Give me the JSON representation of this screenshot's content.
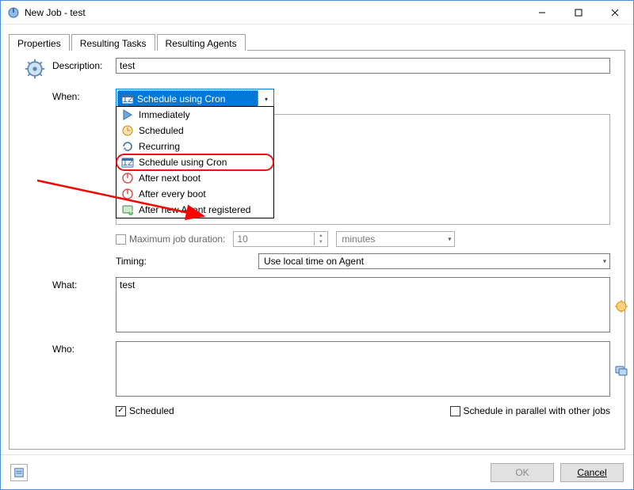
{
  "window": {
    "title": "New Job - test"
  },
  "tabs": [
    "Properties",
    "Resulting Tasks",
    "Resulting Agents"
  ],
  "active_tab": 0,
  "form": {
    "description_label": "Description:",
    "description_value": "test",
    "when_label": "When:",
    "when_selected": "Schedule using Cron",
    "when_options": [
      {
        "icon": "play-icon",
        "label": "Immediately"
      },
      {
        "icon": "clock-icon",
        "label": "Scheduled"
      },
      {
        "icon": "recur-icon",
        "label": "Recurring"
      },
      {
        "icon": "calendar-icon",
        "label": "Schedule using Cron"
      },
      {
        "icon": "boot-icon",
        "label": "After next boot"
      },
      {
        "icon": "boot-icon",
        "label": "After every boot"
      },
      {
        "icon": "agent-icon",
        "label": "After new Agent registered"
      }
    ],
    "max_duration_label": "Maximum job duration:",
    "max_duration_value": "10",
    "max_duration_unit": "minutes",
    "timing_label": "Timing:",
    "timing_value": "Use local time on Agent",
    "what_label": "What:",
    "what_value": "test",
    "who_label": "Who:",
    "who_value": "",
    "scheduled_label": "Scheduled",
    "scheduled_checked": true,
    "parallel_label": "Schedule in parallel with other jobs",
    "parallel_checked": false
  },
  "buttons": {
    "ok": "OK",
    "cancel": "Cancel"
  },
  "annotation": {
    "highlight_option_index": 3
  }
}
